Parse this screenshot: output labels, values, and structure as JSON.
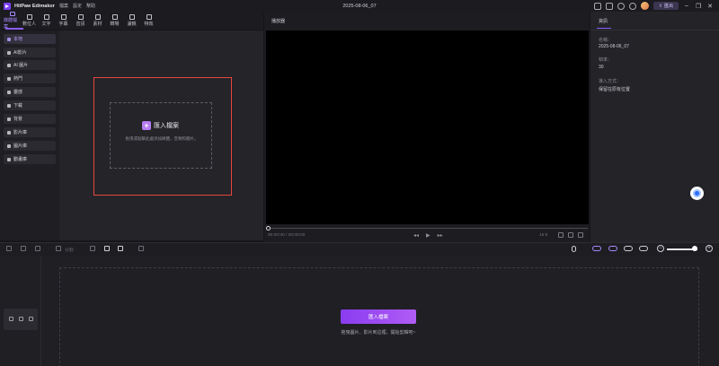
{
  "app": {
    "name": "HitPaw Edimakor",
    "menu": [
      "檔案",
      "設定",
      "幫助"
    ],
    "window_title": "2025-08-06_07",
    "export_label": "匯出"
  },
  "toolbar": {
    "tools": [
      {
        "label": "媒體檔案",
        "icon": "media-icon",
        "active": true
      },
      {
        "label": "數位人",
        "icon": "avatar-icon"
      },
      {
        "label": "文字",
        "icon": "text-icon"
      },
      {
        "label": "字幕",
        "icon": "subtitle-icon"
      },
      {
        "label": "音訊",
        "icon": "audio-icon"
      },
      {
        "label": "素材",
        "icon": "sticker-icon"
      },
      {
        "label": "轉場",
        "icon": "transition-icon"
      },
      {
        "label": "濾鏡",
        "icon": "filter-icon"
      },
      {
        "label": "特效",
        "icon": "effect-icon"
      }
    ]
  },
  "sidebar": {
    "items": [
      {
        "label": "本地",
        "active": true
      },
      {
        "label": "AI影片"
      },
      {
        "label": "AI 圖片"
      },
      {
        "label": "熱門"
      },
      {
        "label": "靈感"
      },
      {
        "label": "下載"
      },
      {
        "label": "背景"
      },
      {
        "label": "影片庫"
      },
      {
        "label": "圖片庫"
      },
      {
        "label": "動畫庫"
      }
    ]
  },
  "media": {
    "import_label": "匯入檔案",
    "drop_hint": "拖曳或點擊此處添加媒體，音頻和圖片。"
  },
  "player": {
    "title": "播放器",
    "current_time": "00:00:00",
    "total_time": "00:00:00",
    "ratio": "16:9"
  },
  "info": {
    "tab": "資訊",
    "name_label": "名稱：",
    "name_value": "2025-08-06_07",
    "fps_label": "幀率：",
    "fps_value": "30",
    "import_mode_label": "導入方式：",
    "import_mode_value": "保留在原有位置"
  },
  "timeline": {
    "split_label": "分割",
    "import_button": "匯入檔案",
    "hint": "拖曳圖片、影片到這裡，開始剪輯吧~"
  }
}
